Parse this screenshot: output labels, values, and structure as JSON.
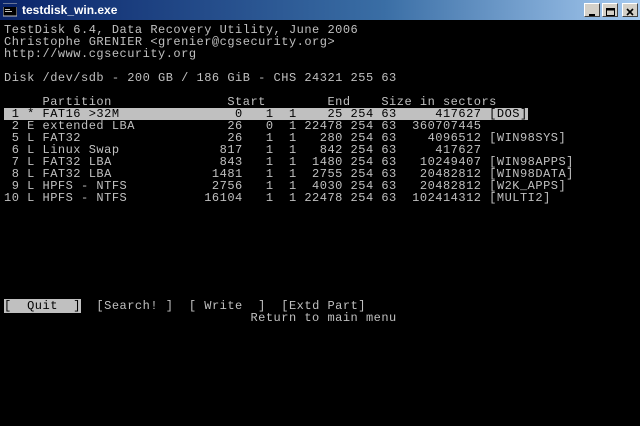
{
  "window": {
    "title": "testdisk_win.exe"
  },
  "console": {
    "header": [
      "TestDisk 6.4, Data Recovery Utility, June 2006",
      "Christophe GRENIER <grenier@cgsecurity.org>",
      "http://www.cgsecurity.org"
    ],
    "disk_info": "Disk /dev/sdb - 200 GB / 186 GiB - CHS 24321 255 63",
    "table_header": "     Partition               Start        End    Size in sectors",
    "rows": [
      " 1 * FAT16 >32M               0   1  1    25 254 63     417627 [DOS]",
      " 2 E extended LBA            26   0  1 22478 254 63  360707445",
      " 5 L FAT32                   26   1  1   280 254 63    4096512 [WIN98SYS]",
      " 6 L Linux Swap             817   1  1   842 254 63     417627",
      " 7 L FAT32 LBA              843   1  1  1480 254 63   10249407 [WIN98APPS]",
      " 8 L FAT32 LBA             1481   1  1  2755 254 63   20482812 [WIN98DATA]",
      " 9 L HPFS - NTFS           2756   1  1  4030 254 63   20482812 [W2K_APPS]",
      "10 L HPFS - NTFS          16104   1  1 22478 254 63  102414312 [MULTI2]"
    ],
    "selected_row": 0,
    "menu": [
      "[  Quit  ]",
      "[Search! ]",
      "[ Write  ]",
      "[Extd Part]"
    ],
    "active_menu": 0,
    "status": "Return to main menu"
  },
  "icons": {
    "app": "console-app-icon",
    "minimize": "minimize-icon",
    "maximize": "maximize-icon",
    "close": "close-icon"
  },
  "colors": {
    "titlebar_start": "#0a246a",
    "console_bg": "#000000",
    "console_fg": "#c0c0c0"
  }
}
